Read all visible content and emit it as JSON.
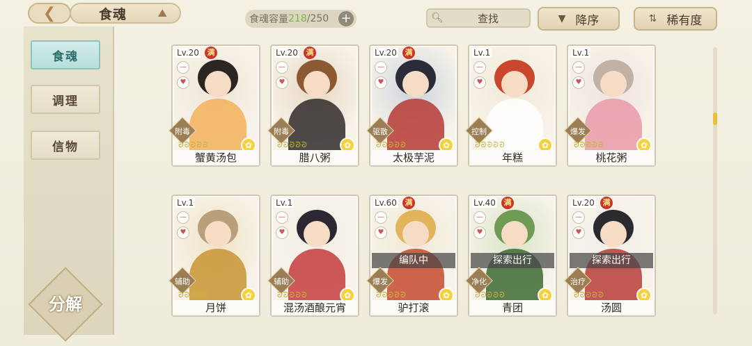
{
  "header": {
    "title": "食魂",
    "capacity_label": "食魂容量",
    "capacity_used": "218",
    "capacity_total": "/250",
    "search_label": "查找",
    "sort_order_label": "降序",
    "sort_rarity_label": "稀有度"
  },
  "sidebar": {
    "tabs": [
      {
        "label": "食魂",
        "active": true
      },
      {
        "label": "调理",
        "active": false
      },
      {
        "label": "信物",
        "active": false
      }
    ],
    "decompose_label": "分解"
  },
  "cards": [
    {
      "level": "Lv.20",
      "max": true,
      "max_label": "满",
      "type": "附毒",
      "name": "蟹黄汤包",
      "status": "",
      "palette": [
        "#f0e6d7",
        "#2b2622",
        "#f3b15a"
      ]
    },
    {
      "level": "Lv.20",
      "max": true,
      "max_label": "满",
      "type": "附毒",
      "name": "腊八粥",
      "status": "",
      "palette": [
        "#e8d7c2",
        "#8b5a33",
        "#2f2a2a"
      ]
    },
    {
      "level": "Lv.20",
      "max": true,
      "max_label": "满",
      "type": "驱散",
      "name": "太极芋泥",
      "status": "",
      "palette": [
        "#cdd3de",
        "#2a2c3a",
        "#b63a34"
      ]
    },
    {
      "level": "Lv.1",
      "max": false,
      "max_label": "",
      "type": "控制",
      "name": "年糕",
      "status": "",
      "palette": [
        "#f3ead8",
        "#c8472d",
        "#ffffff"
      ]
    },
    {
      "level": "Lv.1",
      "max": false,
      "max_label": "",
      "type": "爆发",
      "name": "桃花粥",
      "status": "",
      "palette": [
        "#efe3e1",
        "#c2b2a6",
        "#e79aa8"
      ]
    },
    {
      "level": "Lv.1",
      "max": false,
      "max_label": "",
      "type": "辅助",
      "name": "月饼",
      "status": "",
      "palette": [
        "#f1e4c6",
        "#b7a07a",
        "#c89433"
      ]
    },
    {
      "level": "Lv.1",
      "max": false,
      "max_label": "",
      "type": "辅助",
      "name": "混汤酒酿元宵",
      "status": "",
      "palette": [
        "#f3eee6",
        "#2b2832",
        "#c33d3d"
      ]
    },
    {
      "level": "Lv.60",
      "max": true,
      "max_label": "满",
      "type": "爆发",
      "name": "驴打滚",
      "status": "编队中",
      "palette": [
        "#f2ead7",
        "#e2b45b",
        "#c74a2f"
      ]
    },
    {
      "level": "Lv.40",
      "max": true,
      "max_label": "满",
      "type": "净化",
      "name": "青团",
      "status": "探索出行",
      "palette": [
        "#d9e4c8",
        "#6f9b54",
        "#3d6a33"
      ]
    },
    {
      "level": "Lv.20",
      "max": true,
      "max_label": "满",
      "type": "治疗",
      "name": "汤圆",
      "status": "探索出行",
      "palette": [
        "#f2efea",
        "#2b2a2e",
        "#b83d3a"
      ]
    }
  ],
  "icons": {
    "back": "chevron-left-icon",
    "hat": "hat-icon",
    "plus": "plus-icon",
    "search": "search-icon",
    "sort": "sort-triangle-icon",
    "rarity": "rarity-sort-icon",
    "flower": "flower-icon",
    "heart": "heart-icon"
  },
  "colors": {
    "active_tab": "#b7dedb",
    "capacity_used": "#7cb64c",
    "max_badge": "#c9352b",
    "scroll_thumb": "#e9c03a"
  }
}
